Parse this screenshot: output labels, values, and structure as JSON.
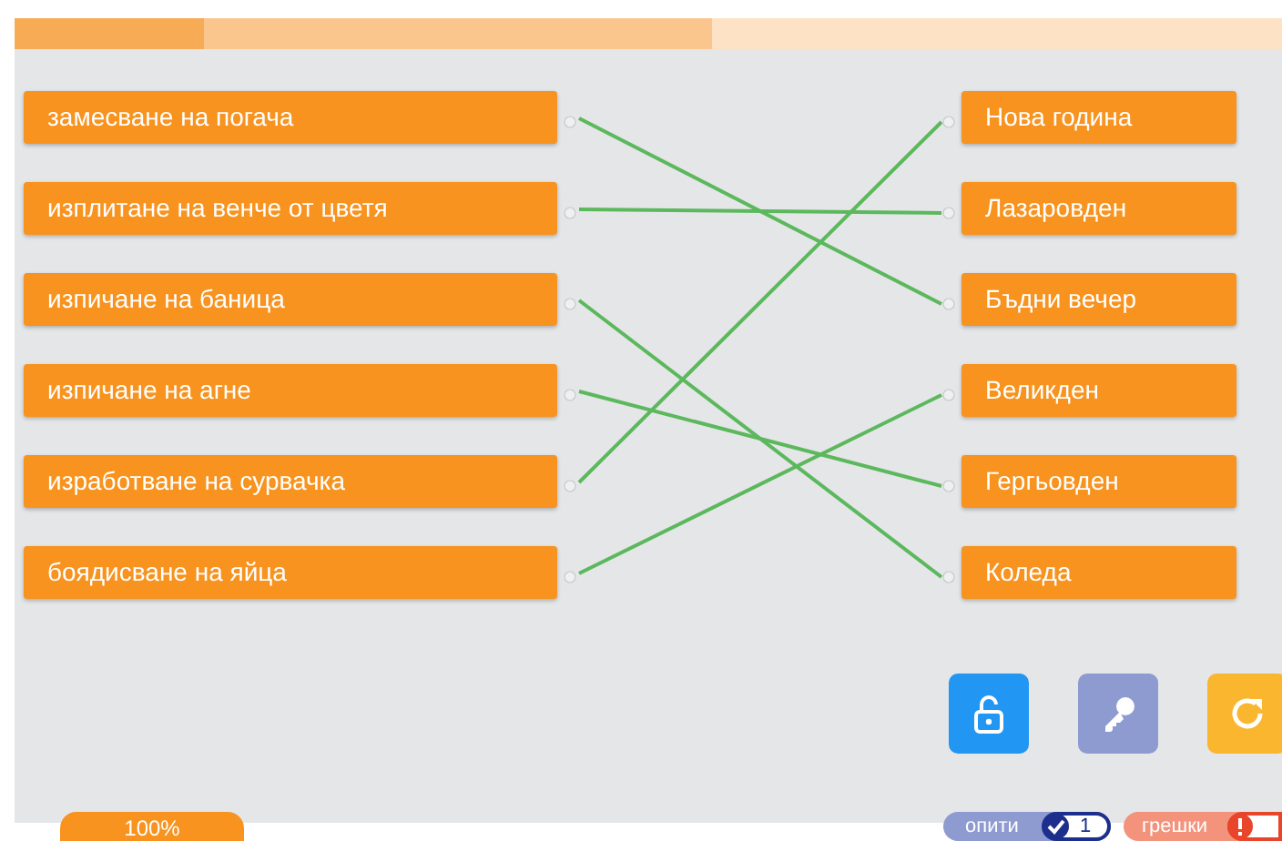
{
  "progress": {
    "level": 0.15
  },
  "loaded": {
    "level": 0.55
  },
  "left_items": [
    {
      "label": "замесване на погача",
      "linked_to": [
        false,
        false,
        true,
        false,
        false,
        false
      ]
    },
    {
      "label": "изплитане на венче от цветя",
      "linked_to": [
        false,
        true,
        false,
        false,
        false,
        false
      ]
    },
    {
      "label": "изпичане на баница",
      "linked_to": [
        false,
        false,
        false,
        false,
        false,
        true
      ]
    },
    {
      "label": "изпичане на агне",
      "linked_to": [
        false,
        false,
        false,
        false,
        true,
        false
      ]
    },
    {
      "label": "изработване на сурвачка",
      "linked_to": [
        true,
        false,
        false,
        false,
        false,
        false
      ]
    },
    {
      "label": "боядисване на яйца",
      "linked_to": [
        false,
        false,
        false,
        true,
        false,
        false
      ]
    }
  ],
  "right_items": [
    {
      "label": "Нова година"
    },
    {
      "label": "Лазаровден"
    },
    {
      "label": "Бъдни вечер"
    },
    {
      "label": "Великден"
    },
    {
      "label": "Гергьовден"
    },
    {
      "label": "Коледа"
    }
  ],
  "buttons": [
    {
      "kind": "unlock"
    },
    {
      "kind": "key"
    },
    {
      "kind": "refresh"
    }
  ],
  "score": "100%",
  "attempts": {
    "label": "опити",
    "count": "1"
  },
  "errors": {
    "label": "грешки"
  }
}
